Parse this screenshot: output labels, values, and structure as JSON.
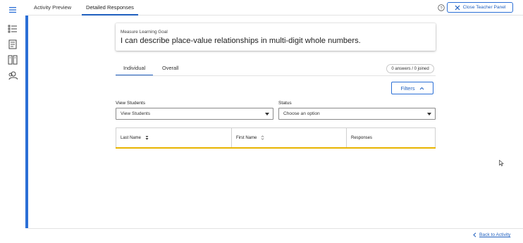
{
  "top_tabs": [
    {
      "label": "Activity Preview"
    },
    {
      "label": "Detailed Responses"
    }
  ],
  "close_panel_label": "Close Teacher Panel",
  "goal": {
    "eyebrow": "Measure Learning Goal",
    "text": "I can describe place-value relationships in multi-digit whole numbers."
  },
  "sub_tabs": [
    {
      "label": "Individual"
    },
    {
      "label": "Overall"
    }
  ],
  "answers_count": "0 answers / 0 joined",
  "filters_label": "Filters",
  "view_students": {
    "label": "View Students",
    "value": "View Students"
  },
  "status": {
    "label": "Status",
    "value": "Choose an option"
  },
  "table": {
    "columns": [
      "Last Name",
      "First Name",
      "Responses"
    ]
  },
  "back_label": "Back to Activity",
  "colors": {
    "accent": "#2b6fd6",
    "link": "#1f5fbf",
    "highlight": "#e8b400"
  },
  "icons": {
    "rail": [
      "menu-icon",
      "list-icon",
      "notebook-icon",
      "columns-icon",
      "people-icon"
    ]
  }
}
